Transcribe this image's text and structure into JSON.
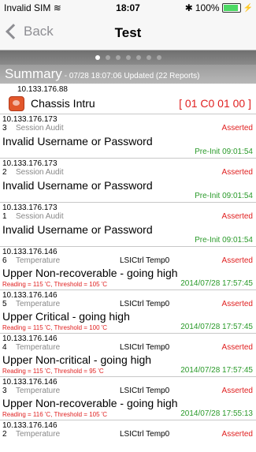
{
  "status_bar": {
    "carrier": "Invalid SIM",
    "time": "18:07",
    "battery": "100%",
    "battery_level": 1.0,
    "bolt": "⚡"
  },
  "nav": {
    "back": "Back",
    "title": "Test"
  },
  "pager": {
    "count": 7,
    "active": 0
  },
  "summary": {
    "label": "Summary",
    "info": "- 07/28 18:07:06 Updated (22 Reports)"
  },
  "chassis": {
    "ip": "10.133.176.88",
    "name": "Chassis Intru",
    "code": "[ 01 C0 01 00 ]"
  },
  "entries": [
    {
      "kind": "audit",
      "ip": "10.133.176.173",
      "num": "3",
      "type": "Session Audit",
      "status": "Asserted",
      "msg": "Invalid Username or Password",
      "time": "Pre-Init 09:01:54"
    },
    {
      "kind": "audit",
      "ip": "10.133.176.173",
      "num": "2",
      "type": "Session Audit",
      "status": "Asserted",
      "msg": "Invalid Username or Password",
      "time": "Pre-Init 09:01:54"
    },
    {
      "kind": "audit",
      "ip": "10.133.176.173",
      "num": "1",
      "type": "Session Audit",
      "status": "Asserted",
      "msg": "Invalid Username or Password",
      "time": "Pre-Init 09:01:54"
    },
    {
      "kind": "temp",
      "ip": "10.133.176.146",
      "num": "6",
      "type": "Temperature",
      "sensor": "LSICtrl Temp0",
      "status": "Asserted",
      "msg": "Upper Non-recoverable - going high",
      "reading": "Reading = 115 'C, Threshold = 105 'C",
      "time": "2014/07/28 17:57:45"
    },
    {
      "kind": "temp",
      "ip": "10.133.176.146",
      "num": "5",
      "type": "Temperature",
      "sensor": "LSICtrl Temp0",
      "status": "Asserted",
      "msg": "Upper Critical - going high",
      "reading": "Reading = 115 'C, Threshold = 100 'C",
      "time": "2014/07/28 17:57:45"
    },
    {
      "kind": "temp",
      "ip": "10.133.176.146",
      "num": "4",
      "type": "Temperature",
      "sensor": "LSICtrl Temp0",
      "status": "Asserted",
      "msg": "Upper Non-critical - going high",
      "reading": "Reading = 115 'C, Threshold = 95 'C",
      "time": "2014/07/28 17:57:45"
    },
    {
      "kind": "temp",
      "ip": "10.133.176.146",
      "num": "3",
      "type": "Temperature",
      "sensor": "LSICtrl Temp0",
      "status": "Asserted",
      "msg": "Upper Non-recoverable - going high",
      "reading": "Reading = 116 'C, Threshold = 105 'C",
      "time": "2014/07/28 17:55:13"
    },
    {
      "kind": "partial",
      "ip": "10.133.176.146",
      "num": "2",
      "type": "Temperature",
      "sensor": "LSICtrl Temp0",
      "status": "Asserted"
    }
  ]
}
